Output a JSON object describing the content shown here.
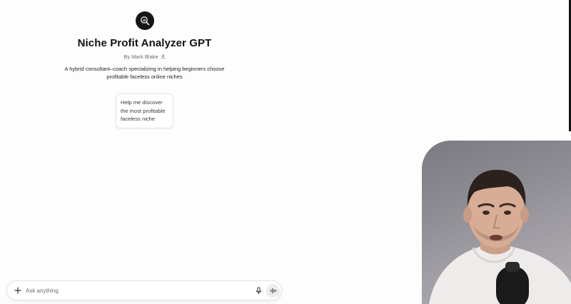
{
  "gpt": {
    "title": "Niche Profit Analyzer GPT",
    "author": "By Mark Blake",
    "description_line1": "A hybrid consultant–coach specializing in helping beginners choose",
    "description_line2": "profitable faceless online niches",
    "logo_icon": "magnifier-chart-icon"
  },
  "conversation_starters": [
    {
      "line1": "Help me discover",
      "line2": "the most profitable",
      "line3": "faceless niche"
    }
  ],
  "composer": {
    "placeholder": "Ask anything",
    "plus_icon": "plus-icon",
    "mic_icon": "microphone-icon",
    "voice_icon": "voice-mode-icon"
  },
  "webcam": {
    "subject": "presenter-video-overlay"
  }
}
